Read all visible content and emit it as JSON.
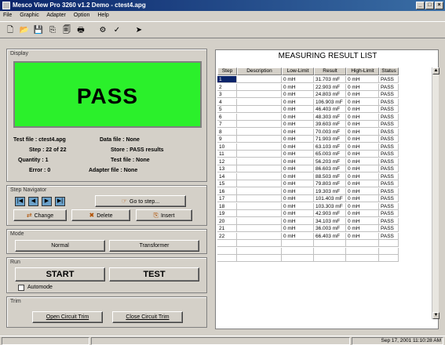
{
  "window": {
    "title": "Mesco View Pro 3260 v1.2 Demo - ctest4.apg",
    "minimize": "_",
    "maximize": "□",
    "close": "×"
  },
  "menu": [
    "File",
    "Graphic",
    "Adapter",
    "Option",
    "Help"
  ],
  "toolbar": {
    "icons": [
      "new-icon",
      "open-icon",
      "save-icon",
      "copy-icon",
      "print-preview-icon",
      "print-icon",
      "settings-icon",
      "check-icon",
      "run-icon"
    ],
    "glyphs": [
      "🗋",
      "📂",
      "💾",
      "⎘",
      "🗐",
      "🖶",
      "⚙",
      "✓",
      "➤"
    ]
  },
  "display": {
    "label": "Display",
    "value": "PASS",
    "color": "#2bf02b"
  },
  "info": {
    "test_file": "Test file : ctest4.apg",
    "data_file": "Data file : None",
    "step": "Step : 22 of  22",
    "store": "Store : PASS results",
    "quantity": "Quantity : 1",
    "test_file2": "Test file : None",
    "error": "Error : 0",
    "adapter_file": "Adapter file : None"
  },
  "navigator": {
    "label": "Step Navigator",
    "buttons": [
      "|◀",
      "◀",
      "▶",
      "▶|"
    ],
    "goto": "Go to step...",
    "change": "Change",
    "delete": "Delete",
    "insert": "Insert"
  },
  "mode": {
    "label": "Mode",
    "normal": "Normal",
    "transformer": "Transformer"
  },
  "run": {
    "label": "Run",
    "start": "START",
    "test": "TEST",
    "automode": "Automode"
  },
  "trim": {
    "label": "Trim",
    "open": "Open Circuit Trim",
    "close": "Close Circuit Trim"
  },
  "table": {
    "title": "MEASURING RESULT LIST",
    "columns": [
      "Step",
      "Description",
      "Low-Limit",
      "Result",
      "High-Limit",
      "Status"
    ],
    "rows": [
      [
        "1",
        "",
        "0 mH",
        "31.703 mF",
        "0 mH",
        "PASS"
      ],
      [
        "2",
        "",
        "0 mH",
        "22.903 mF",
        "0 mH",
        "PASS"
      ],
      [
        "3",
        "",
        "0 mH",
        "24.803 mF",
        "0 mH",
        "PASS"
      ],
      [
        "4",
        "",
        "0 mH",
        "106.903 mF",
        "0 mH",
        "PASS"
      ],
      [
        "5",
        "",
        "0 mH",
        "46.403 mF",
        "0 mH",
        "PASS"
      ],
      [
        "6",
        "",
        "0 mH",
        "48.303 mF",
        "0 mH",
        "PASS"
      ],
      [
        "7",
        "",
        "0 mH",
        "39.603 mF",
        "0 mH",
        "PASS"
      ],
      [
        "8",
        "",
        "0 mH",
        "70.003 mF",
        "0 mH",
        "PASS"
      ],
      [
        "9",
        "",
        "0 mH",
        "71.903 mF",
        "0 mH",
        "PASS"
      ],
      [
        "10",
        "",
        "0 mH",
        "63.103 mF",
        "0 mH",
        "PASS"
      ],
      [
        "11",
        "",
        "0 mH",
        "65.003 mF",
        "0 mH",
        "PASS"
      ],
      [
        "12",
        "",
        "0 mH",
        "56.203 mF",
        "0 mH",
        "PASS"
      ],
      [
        "13",
        "",
        "0 mH",
        "86.603 mF",
        "0 mH",
        "PASS"
      ],
      [
        "14",
        "",
        "0 mH",
        "88.503 mF",
        "0 mH",
        "PASS"
      ],
      [
        "15",
        "",
        "0 mH",
        "79.803 mF",
        "0 mH",
        "PASS"
      ],
      [
        "16",
        "",
        "0 mH",
        "19.303 mF",
        "0 mH",
        "PASS"
      ],
      [
        "17",
        "",
        "0 mH",
        "101.403 mF",
        "0 mH",
        "PASS"
      ],
      [
        "18",
        "",
        "0 mH",
        "103.303 mF",
        "0 mH",
        "PASS"
      ],
      [
        "19",
        "",
        "0 mH",
        "42.903 mF",
        "0 mH",
        "PASS"
      ],
      [
        "20",
        "",
        "0 mH",
        "34.103 mF",
        "0 mH",
        "PASS"
      ],
      [
        "21",
        "",
        "0 mH",
        "36.003 mF",
        "0 mH",
        "PASS"
      ],
      [
        "22",
        "",
        "0 mH",
        "66.403 mF",
        "0 mH",
        "PASS"
      ]
    ],
    "selected_step": "1"
  },
  "status": {
    "datetime": "Sep 17, 2001  11:10:28 AM"
  }
}
